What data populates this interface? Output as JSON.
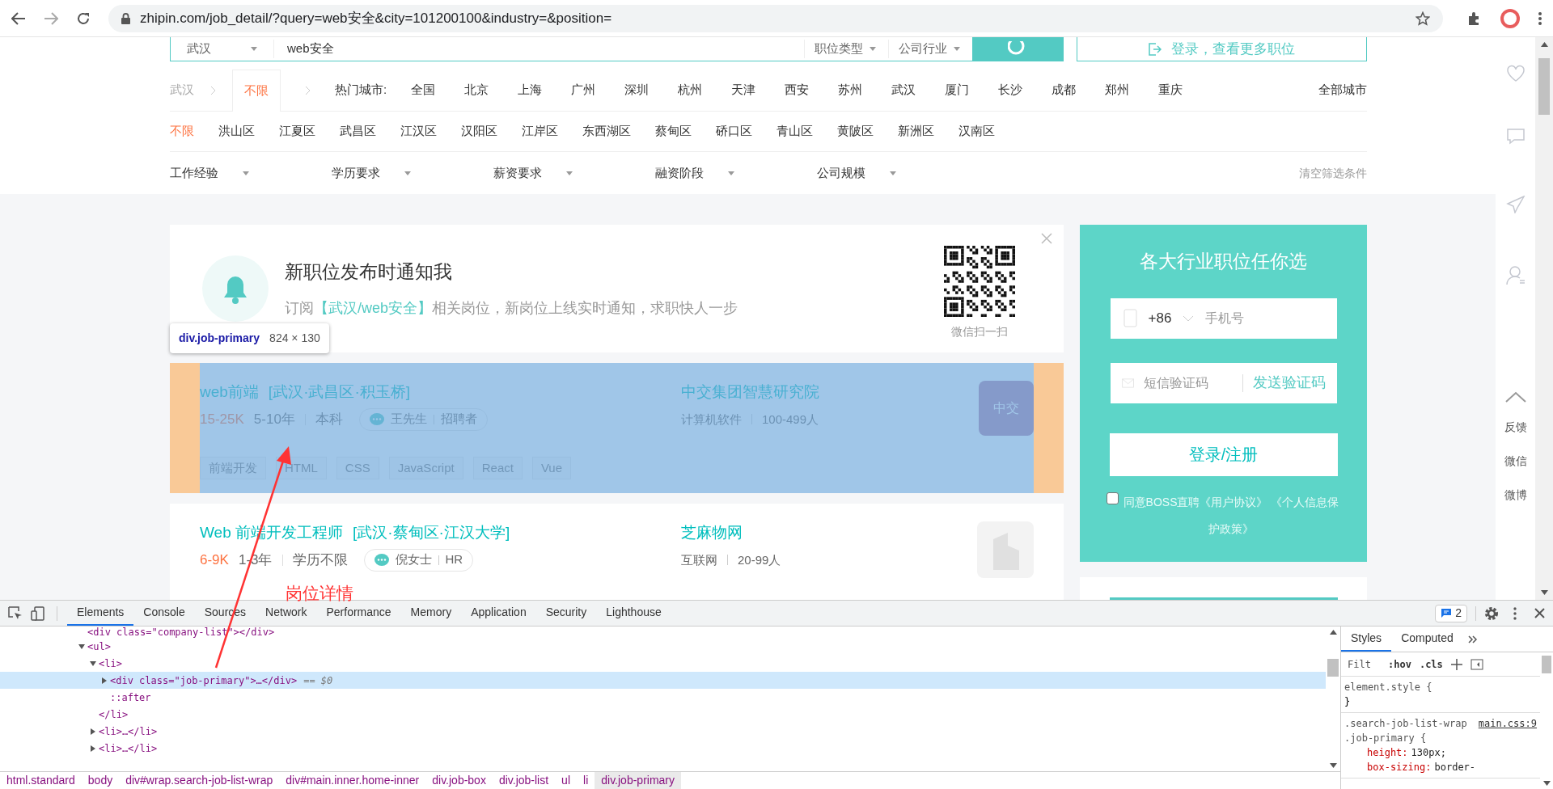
{
  "browser": {
    "url": "zhipin.com/job_detail/?query=web安全&city=101200100&industry=&position="
  },
  "search_bar": {
    "city": "武汉",
    "query": "web安全",
    "filters": [
      "职位类型",
      "公司行业"
    ],
    "login": "登录，查看更多职位"
  },
  "city_row": {
    "breadcrumb": "武汉",
    "current": "不限",
    "hot_label": "热门城市:",
    "cities": [
      "全国",
      "北京",
      "上海",
      "广州",
      "深圳",
      "杭州",
      "天津",
      "西安",
      "苏州",
      "武汉",
      "厦门",
      "长沙",
      "成都",
      "郑州",
      "重庆"
    ],
    "all": "全部城市"
  },
  "districts": [
    {
      "label": "不限",
      "selected": true
    },
    {
      "label": "洪山区",
      "selected": false
    },
    {
      "label": "江夏区",
      "selected": false
    },
    {
      "label": "武昌区",
      "selected": false
    },
    {
      "label": "江汉区",
      "selected": false
    },
    {
      "label": "汉阳区",
      "selected": false
    },
    {
      "label": "江岸区",
      "selected": false
    },
    {
      "label": "东西湖区",
      "selected": false
    },
    {
      "label": "蔡甸区",
      "selected": false
    },
    {
      "label": "硚口区",
      "selected": false
    },
    {
      "label": "青山区",
      "selected": false
    },
    {
      "label": "黄陂区",
      "selected": false
    },
    {
      "label": "新洲区",
      "selected": false
    },
    {
      "label": "汉南区",
      "selected": false
    }
  ],
  "filters": [
    "工作经验",
    "学历要求",
    "薪资要求",
    "融资阶段",
    "公司规模"
  ],
  "clear_filters": "清空筛选条件",
  "notify": {
    "title": "新职位发布时通知我",
    "text": "订阅",
    "highlight": "【武汉/web安全】",
    "text_end": "相关岗位，新岗位上线实时通知，求职快人一步",
    "qr_caption": "微信扫一扫"
  },
  "inspector_tooltip": {
    "selector": "div.job-primary",
    "size": "824 × 130"
  },
  "jobs": [
    {
      "title": "web前端",
      "location": "[武汉·武昌区·积玉桥]",
      "salary": "15-25K",
      "experience": "5-10年",
      "education": "本科",
      "recruiter": "王先生",
      "recruiter_role": "招聘者",
      "company": "中交集团智慧研究院",
      "industry": "计算机软件",
      "size": "100-499人",
      "logo_text": "中交",
      "tags": [
        "前端开发",
        "HTML",
        "CSS",
        "JavaScript",
        "React",
        "Vue"
      ],
      "highlighted": true
    },
    {
      "title": "Web 前端开发工程师",
      "location": "[武汉·蔡甸区·江汉大学]",
      "salary": "6-9K",
      "experience": "1-3年",
      "education": "学历不限",
      "recruiter": "倪女士",
      "recruiter_role": "HR",
      "company": "芝麻物网",
      "industry": "互联网",
      "size": "20-99人",
      "highlighted": false
    }
  ],
  "annotation": {
    "text": "岗位详情"
  },
  "login_panel": {
    "title": "各大行业职位任你选",
    "country_code": "+86",
    "phone_placeholder": "手机号",
    "code_placeholder": "短信验证码",
    "send_code": "发送验证码",
    "submit": "登录/注册",
    "agree_checked": false,
    "agreement": "同意BOSS直聘《用户协议》 《个人信息保护政策》"
  },
  "side_tools": [
    "反馈",
    "微信",
    "微博"
  ],
  "devtools": {
    "tabs": [
      {
        "label": "Elements",
        "selected": true
      },
      {
        "label": "Console",
        "selected": false
      },
      {
        "label": "Sources",
        "selected": false
      },
      {
        "label": "Network",
        "selected": false
      },
      {
        "label": "Performance",
        "selected": false
      },
      {
        "label": "Memory",
        "selected": false
      },
      {
        "label": "Application",
        "selected": false
      },
      {
        "label": "Security",
        "selected": false
      },
      {
        "label": "Lighthouse",
        "selected": false
      }
    ],
    "issues": "2",
    "dom_top": "<div class=\"company-list\"></div>",
    "dom": [
      {
        "text": "<ul>",
        "expanded": true,
        "selected": false,
        "children": [
          {
            "text": "<li>",
            "expanded": true,
            "selected": false,
            "closing": "</li>",
            "children": [
              {
                "text": "<div class=\"job-primary\">…</div>",
                "expanded": false,
                "selected": true,
                "suffix": "== $0"
              },
              {
                "text": "::after",
                "selected": false
              }
            ]
          },
          {
            "text": "<li>…</li>",
            "expanded": false,
            "selected": false
          },
          {
            "text": "<li>…</li>",
            "expanded": false,
            "selected": false
          }
        ]
      }
    ],
    "breadcrumbs": [
      {
        "label": "html.standard",
        "selected": false
      },
      {
        "label": "body",
        "selected": false
      },
      {
        "label": "div#wrap.search-job-list-wrap",
        "selected": false
      },
      {
        "label": "div#main.inner.home-inner",
        "selected": false
      },
      {
        "label": "div.job-box",
        "selected": false
      },
      {
        "label": "div.job-list",
        "selected": false
      },
      {
        "label": "ul",
        "selected": false
      },
      {
        "label": "li",
        "selected": false
      },
      {
        "label": "div.job-primary",
        "selected": true
      }
    ],
    "style_tabs": [
      {
        "label": "Styles",
        "selected": true
      },
      {
        "label": "Computed",
        "selected": false
      }
    ],
    "filter_placeholder": "Filt",
    "hov": ":hov",
    "cls": ".cls",
    "rules": [
      {
        "selector": "element.style {",
        "close": "}"
      },
      {
        "selector": ".search-job-list-wrap .job-primary {",
        "source": "main.css:9",
        "props": [
          {
            "name": "height:",
            "value": "130px;"
          },
          {
            "name": "box-sizing:",
            "value": "border-"
          }
        ]
      }
    ]
  }
}
